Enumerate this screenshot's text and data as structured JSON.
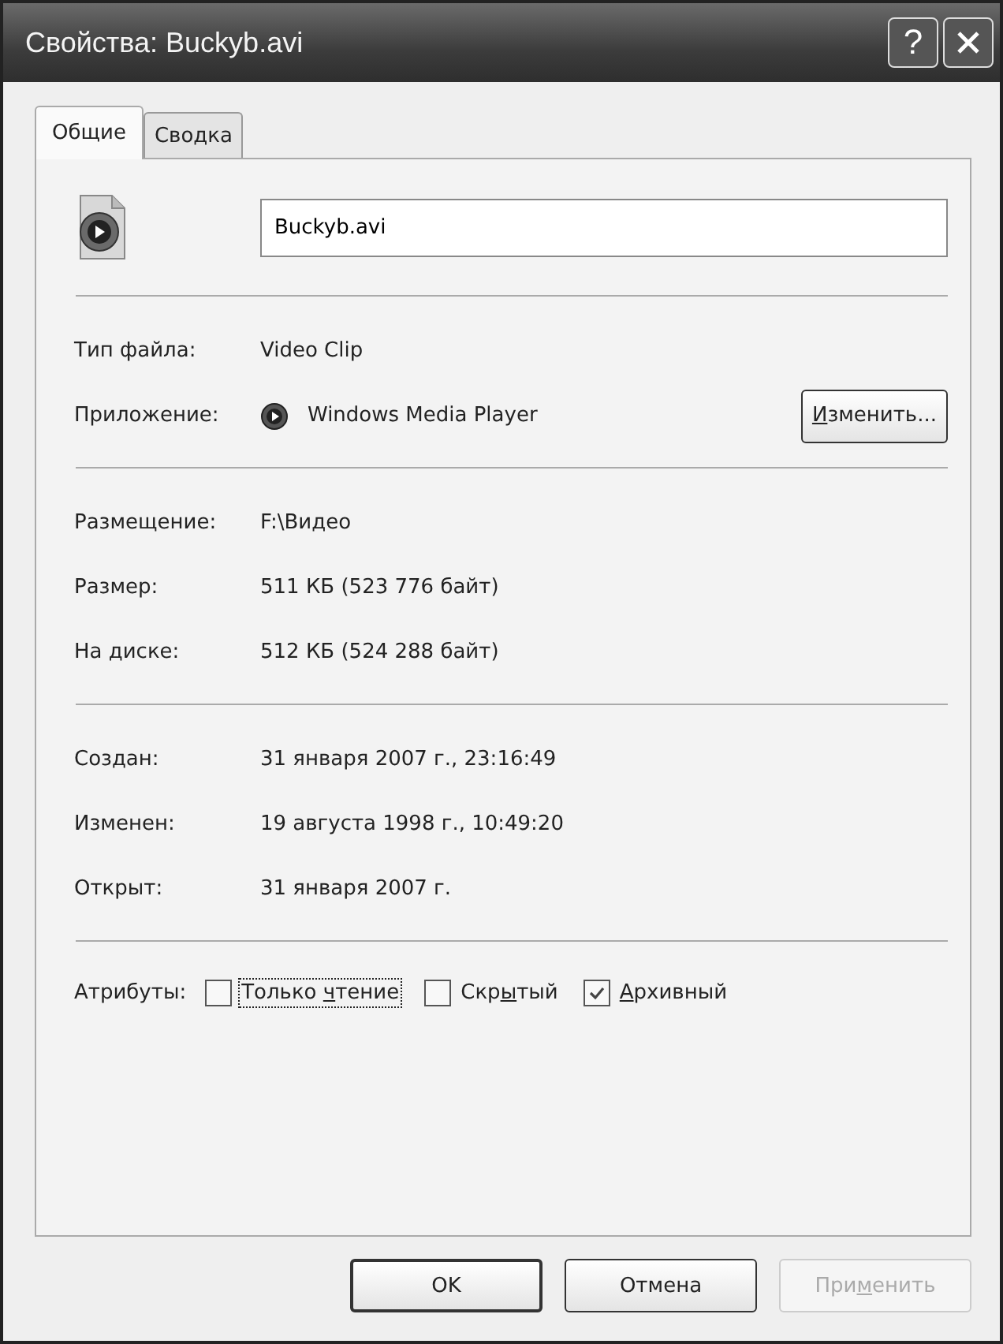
{
  "window": {
    "title": "Свойства: Buckyb.avi",
    "help_button": "?"
  },
  "tabs": [
    {
      "label": "Общие",
      "selected": true
    },
    {
      "label": "Сводка",
      "selected": false
    }
  ],
  "file_name": {
    "value": "Buckyb.avi"
  },
  "sections": [
    {
      "rows": [
        {
          "kind": "text",
          "label": "Тип файла:",
          "value": "Video Clip"
        },
        {
          "kind": "app",
          "label": "Приложение:",
          "value": "Windows Media Player",
          "button": {
            "key": "И",
            "after": "зменить..."
          }
        }
      ]
    },
    {
      "rows": [
        {
          "kind": "text",
          "label": "Размещение:",
          "value": "F:\\Видео"
        },
        {
          "kind": "text",
          "label": "Размер:",
          "value": "511 КБ (523 776 байт)"
        },
        {
          "kind": "text",
          "label": "На диске:",
          "value": "512 КБ (524 288 байт)"
        }
      ]
    },
    {
      "rows": [
        {
          "kind": "text",
          "label": "Создан:",
          "value": "31 января 2007 г., 23:16:49"
        },
        {
          "kind": "text",
          "label": "Изменен:",
          "value": "19 августа 1998 г., 10:49:20"
        },
        {
          "kind": "text",
          "label": "Открыт:",
          "value": "31 января 2007 г."
        }
      ]
    }
  ],
  "attributes": {
    "label": "Атрибуты:",
    "items": [
      {
        "before": "Только ",
        "key": "ч",
        "after": "тение",
        "checked": false,
        "focused": true
      },
      {
        "before": "Скр",
        "key": "ы",
        "after": "тый",
        "checked": false,
        "focused": false
      },
      {
        "key": "А",
        "after": "рхивный",
        "checked": true,
        "focused": false
      }
    ]
  },
  "buttons": [
    {
      "before": "OK",
      "kind": "default",
      "disabled": false
    },
    {
      "before": "Отмена",
      "kind": "normal",
      "disabled": false
    },
    {
      "before": "При",
      "key": "м",
      "after": "енить",
      "kind": "normal",
      "disabled": true
    }
  ]
}
